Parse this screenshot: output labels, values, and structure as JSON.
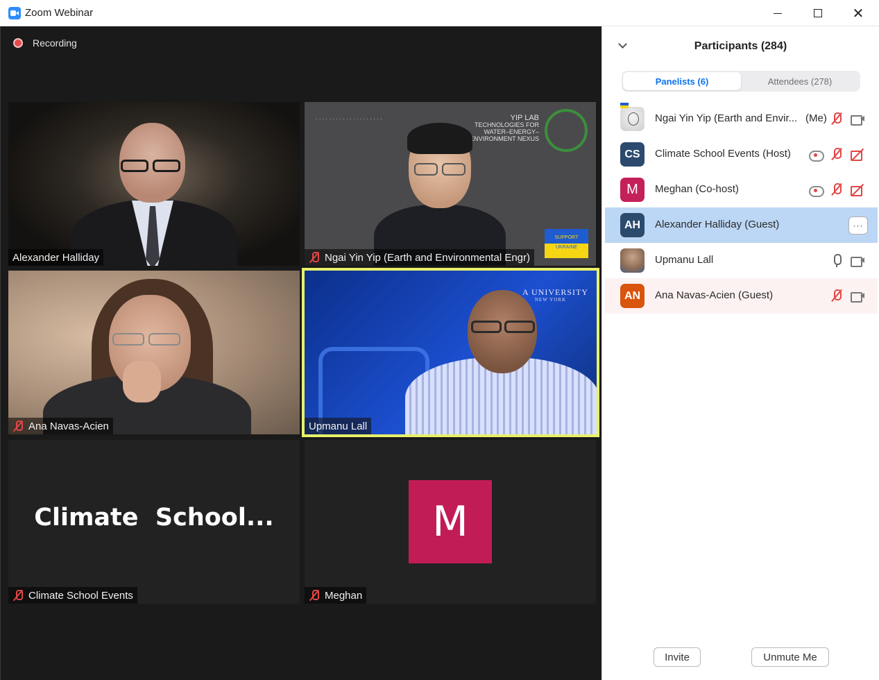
{
  "window": {
    "title": "Zoom Webinar"
  },
  "stage": {
    "recording_label": "Recording",
    "tiles": [
      {
        "name": "Alexander Halliday",
        "muted": false
      },
      {
        "name": "Ngai Yin Yip (Earth and Environmental Engr)",
        "muted": true,
        "logo_title": "YIP LAB",
        "logo_lines": [
          "TECHNOLOGIES FOR",
          "WATER–ENERGY–",
          "ENVIRONMENT NEXUS"
        ],
        "flag_text": [
          "SUPPORT",
          "UKRAINE"
        ]
      },
      {
        "name": "Ana Navas-Acien",
        "muted": true
      },
      {
        "name": "Upmanu Lall",
        "muted": false,
        "active_speaker": true,
        "background_text": "A UNIVERSITY",
        "background_subtext": "NEW YORK"
      },
      {
        "name": "Climate School Events",
        "muted": true,
        "display_text": "Climate  School..."
      },
      {
        "name": "Meghan",
        "muted": true,
        "avatar_letter": "M",
        "avatar_color": "#c21c57"
      }
    ]
  },
  "panel": {
    "title": "Participants (284)",
    "tabs": [
      {
        "label": "Panelists (6)",
        "active": true
      },
      {
        "label": "Attendees (278)",
        "active": false
      }
    ],
    "participants": [
      {
        "name": "Ngai Yin Yip (Earth and Envir...",
        "suffix": "(Me)",
        "avatar": "photo",
        "icons": [
          "mic-muted-icon",
          "camera-icon"
        ]
      },
      {
        "name": "Climate School Events (Host)",
        "initials": "CS",
        "avatar_color": "#2c4a6e",
        "icons": [
          "recording-icon",
          "mic-muted-icon",
          "camera-off-icon"
        ]
      },
      {
        "name": "Meghan (Co-host)",
        "initials": "M",
        "avatar_color": "#c4205a",
        "icons": [
          "recording-icon",
          "mic-muted-icon",
          "camera-off-icon"
        ]
      },
      {
        "name": "Alexander Halliday (Guest)",
        "initials": "AH",
        "avatar_color": "#2c4a6e",
        "selected": true,
        "more_label": "···"
      },
      {
        "name": "Upmanu Lall",
        "avatar": "photo",
        "icons": [
          "mic-icon",
          "camera-icon"
        ]
      },
      {
        "name": "Ana Navas-Acien (Guest)",
        "initials": "AN",
        "avatar_color": "#d9540d",
        "icons": [
          "mic-muted-icon",
          "camera-icon"
        ]
      }
    ],
    "footer": {
      "invite_label": "Invite",
      "unmute_label": "Unmute Me"
    }
  }
}
